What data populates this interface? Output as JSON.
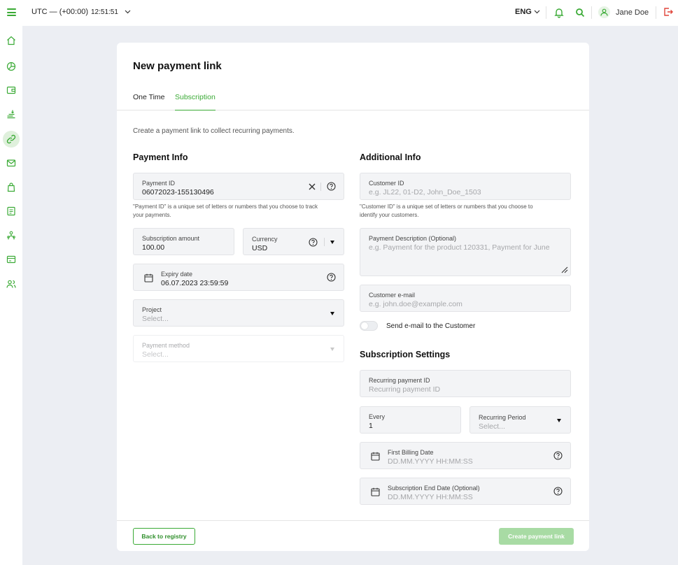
{
  "header": {
    "timezone": "UTC — (+00:00)",
    "time": "12:51:51",
    "language": "ENG",
    "user_name": "Jane Doe"
  },
  "sidebar": {
    "items": [
      {
        "icon": "home-icon",
        "active": false
      },
      {
        "icon": "pie-chart-icon",
        "active": false
      },
      {
        "icon": "wallet-icon",
        "active": false
      },
      {
        "icon": "payouts-icon",
        "active": false
      },
      {
        "icon": "link-icon",
        "active": true
      },
      {
        "icon": "mail-icon",
        "active": false
      },
      {
        "icon": "bag-icon",
        "active": false
      },
      {
        "icon": "document-icon",
        "active": false
      },
      {
        "icon": "users-tree-icon",
        "active": false
      },
      {
        "icon": "card-icon",
        "active": false
      },
      {
        "icon": "people-icon",
        "active": false
      }
    ]
  },
  "page": {
    "title": "New payment link",
    "tabs": [
      "One Time",
      "Subscription"
    ],
    "active_tab": "Subscription",
    "intro": "Create a payment link to collect recurring payments."
  },
  "payment_info": {
    "title": "Payment Info",
    "payment_id_label": "Payment ID",
    "payment_id_value": "06072023-155130496",
    "payment_id_hint_1": "\"Payment ID\" is a unique set of letters or numbers that you choose to track",
    "payment_id_hint_2": "your payments.",
    "amount_label": "Subscription amount",
    "amount_value": "100.00",
    "currency_label": "Currency",
    "currency_value": "USD",
    "expiry_label": "Expiry date",
    "expiry_value": "06.07.2023  23:59:59",
    "project_label": "Project",
    "project_placeholder": "Select...",
    "method_label": "Payment method",
    "method_placeholder": "Select..."
  },
  "additional_info": {
    "title": "Additional Info",
    "customer_id_label": "Customer ID",
    "customer_id_placeholder": "e.g. JL22, 01-D2, John_Doe_1503",
    "customer_id_hint_1": "\"Customer ID\" is a unique set of letters or numbers that you choose to",
    "customer_id_hint_2": "identify your customers.",
    "description_label": "Payment Description (Optional)",
    "description_placeholder": "e.g. Payment for the product 120331, Payment for June",
    "email_label": "Customer e-mail",
    "email_placeholder": "e.g. john.doe@example.com",
    "send_email_label": "Send e-mail to the Customer",
    "send_email_on": false
  },
  "subscription_settings": {
    "title": "Subscription Settings",
    "recurring_id_label": "Recurring payment ID",
    "recurring_id_placeholder": "Recurring payment ID",
    "every_label": "Every",
    "every_value": "1",
    "period_label": "Recurring Period",
    "period_placeholder": "Select...",
    "first_billing_label": "First Billing Date",
    "first_billing_placeholder": "DD.MM.YYYY HH:MM:SS",
    "end_date_label": "Subscription End Date (Optional)",
    "end_date_placeholder": "DD.MM.YYYY HH:MM:SS"
  },
  "footer": {
    "back_label": "Back to registry",
    "create_label": "Create payment link"
  },
  "colors": {
    "accent": "#3aaa35",
    "button_disabled": "#a8dba4",
    "page_bg": "#eceef3"
  }
}
